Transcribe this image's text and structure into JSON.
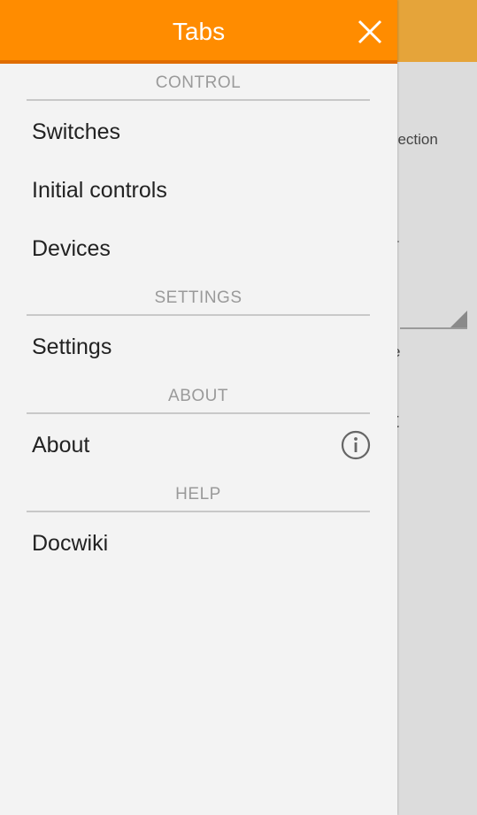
{
  "drawer": {
    "title": "Tabs",
    "close_icon": "close-icon",
    "sections": [
      {
        "header": "CONTROL",
        "items": [
          {
            "label": "Switches"
          },
          {
            "label": "Initial controls"
          },
          {
            "label": "Devices"
          }
        ]
      },
      {
        "header": "SETTINGS",
        "items": [
          {
            "label": "Settings"
          }
        ]
      },
      {
        "header": "ABOUT",
        "items": [
          {
            "label": "About",
            "icon": "info-icon"
          }
        ]
      },
      {
        "header": "HELP",
        "items": [
          {
            "label": "Docwiki"
          }
        ]
      }
    ]
  },
  "background": {
    "text_1": "nection",
    "text_2": "e",
    "text_3": "t"
  },
  "colors": {
    "accent": "#ff8c00",
    "accent_dark": "#e06d00",
    "drawer_bg": "#f3f3f3",
    "section_header_text": "#9a9a9a"
  }
}
